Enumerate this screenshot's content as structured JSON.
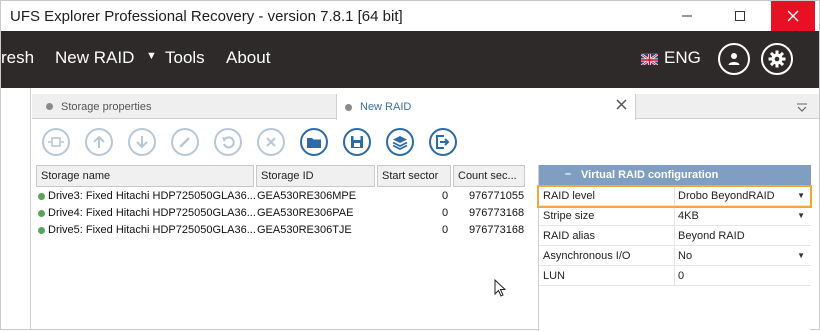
{
  "window": {
    "title": "UFS Explorer Professional Recovery - version 7.8.1 [64 bit]"
  },
  "menubar": {
    "items": [
      "resh",
      "New RAID",
      "Tools",
      "About"
    ],
    "new_raid_arrow": "▼",
    "language": "ENG"
  },
  "tabs": [
    {
      "label": "Storage properties",
      "active": false
    },
    {
      "label": "New RAID",
      "active": true
    }
  ],
  "toolbar": {
    "buttons": [
      "raid-replace-icon",
      "up-icon",
      "down-icon",
      "edit-icon",
      "undo-icon",
      "remove-icon",
      "open-folder-icon",
      "save-icon",
      "layers-icon",
      "export-icon"
    ]
  },
  "table": {
    "columns": [
      "Storage name",
      "Storage ID",
      "Start sector",
      "Count sec..."
    ],
    "rows": [
      {
        "name": "Drive3: Fixed Hitachi HDP725050GLA36...",
        "id": "GEA530RE306MPE",
        "start": "0",
        "count": "976771055"
      },
      {
        "name": "Drive4: Fixed Hitachi HDP725050GLA36...",
        "id": "GEA530RE306PAE",
        "start": "0",
        "count": "976773168"
      },
      {
        "name": "Drive5: Fixed Hitachi HDP725050GLA36...",
        "id": "GEA530RE306TJE",
        "start": "0",
        "count": "976773168"
      }
    ]
  },
  "config": {
    "header": "Virtual RAID configuration",
    "collapse_glyph": "–",
    "rows": [
      {
        "key": "RAID level",
        "value": "Drobo BeyondRAID",
        "dropdown": true
      },
      {
        "key": "Stripe size",
        "value": "4KB",
        "dropdown": true
      },
      {
        "key": "RAID alias",
        "value": "Beyond RAID",
        "dropdown": false
      },
      {
        "key": "Asynchronous I/O",
        "value": "No",
        "dropdown": true
      },
      {
        "key": "LUN",
        "value": "0",
        "dropdown": false
      }
    ]
  },
  "colors": {
    "menubar": "#2e2a2a",
    "accent": "#2c6aa8",
    "panel_header": "#7f9ec2",
    "highlight": "#f2a83b",
    "close": "#e81123"
  }
}
